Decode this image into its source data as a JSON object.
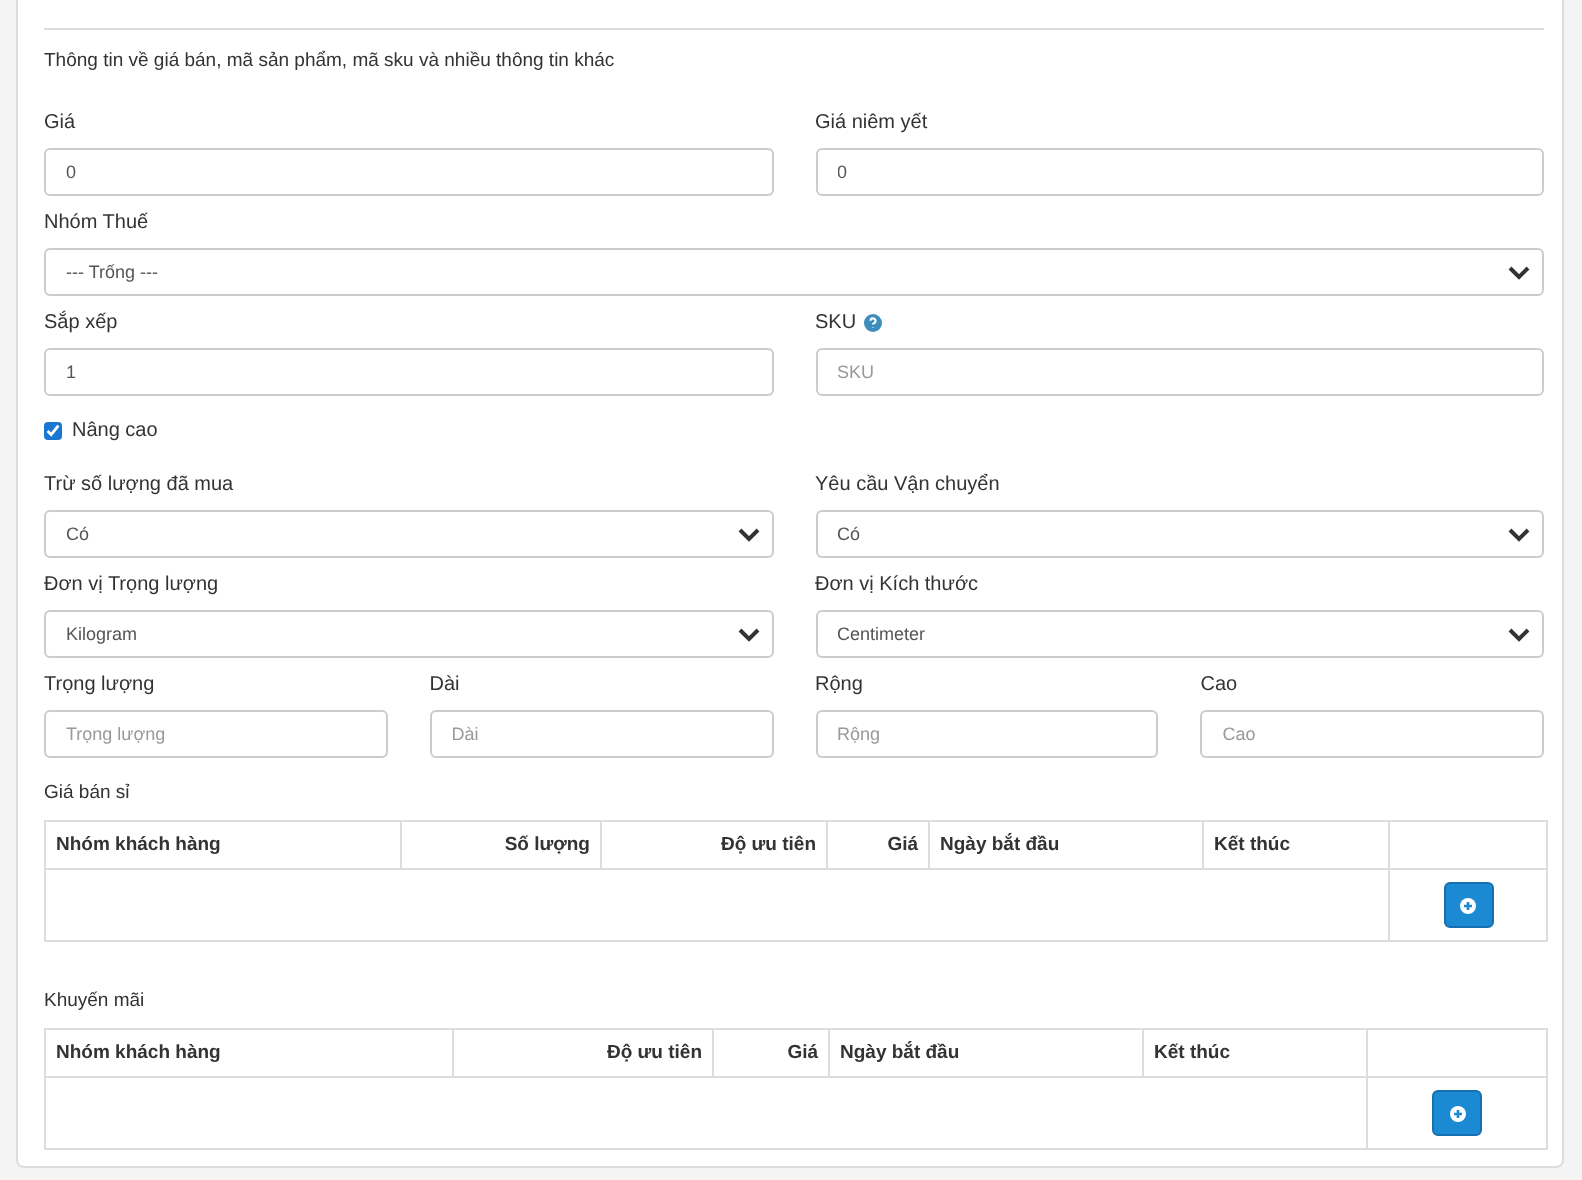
{
  "description": "Thông tin về giá bán, mã sản phẩm, mã sku và nhiều thông tin khác",
  "rows": [
    [
      {
        "kind": "input",
        "label": "Giá",
        "value": "0"
      },
      {
        "kind": "input",
        "label": "Giá niêm yết",
        "value": "0"
      }
    ],
    [
      {
        "kind": "select",
        "label": "Nhóm Thuế",
        "value": "--- Trống ---"
      }
    ],
    [
      {
        "kind": "input",
        "label": "Sắp xếp",
        "value": "1"
      },
      {
        "kind": "input",
        "label": "SKU",
        "placeholder": "SKU",
        "help": true
      }
    ]
  ],
  "advanced": {
    "label": "Nâng cao",
    "checked": true
  },
  "advanced_rows": [
    [
      {
        "kind": "select",
        "label": "Trừ số lượng đã mua",
        "value": "Có"
      },
      {
        "kind": "select",
        "label": "Yêu cầu Vận chuyển",
        "value": "Có"
      }
    ],
    [
      {
        "kind": "select",
        "label": "Đơn vị Trọng lượng",
        "value": "Kilogram"
      },
      {
        "kind": "select",
        "label": "Đơn vị Kích thước",
        "value": "Centimeter"
      }
    ],
    [
      {
        "kind": "input",
        "label": "Trọng lượng",
        "placeholder": "Trọng lượng"
      },
      {
        "kind": "input",
        "label": "Dài",
        "placeholder": "Dài"
      },
      {
        "kind": "input",
        "label": "Rộng",
        "placeholder": "Rộng"
      },
      {
        "kind": "input",
        "label": "Cao",
        "placeholder": "Cao"
      }
    ]
  ],
  "tables": [
    {
      "title": "Giá bán sỉ",
      "columns": [
        {
          "label": "Nhóm khách hàng",
          "kind": "text"
        },
        {
          "label": "Số lượng",
          "kind": "number"
        },
        {
          "label": "Độ ưu tiên",
          "kind": "number"
        },
        {
          "label": "Giá",
          "kind": "number"
        },
        {
          "label": "Ngày bắt đầu",
          "kind": "text"
        },
        {
          "label": "Kết thúc",
          "kind": "text"
        }
      ]
    },
    {
      "title": "Khuyến mãi",
      "columns": [
        {
          "label": "Nhóm khách hàng",
          "kind": "text"
        },
        {
          "label": "Độ ưu tiên",
          "kind": "number"
        },
        {
          "label": "Giá",
          "kind": "number"
        },
        {
          "label": "Ngày bắt đầu",
          "kind": "text"
        },
        {
          "label": "Kết thúc",
          "kind": "text"
        }
      ]
    }
  ]
}
